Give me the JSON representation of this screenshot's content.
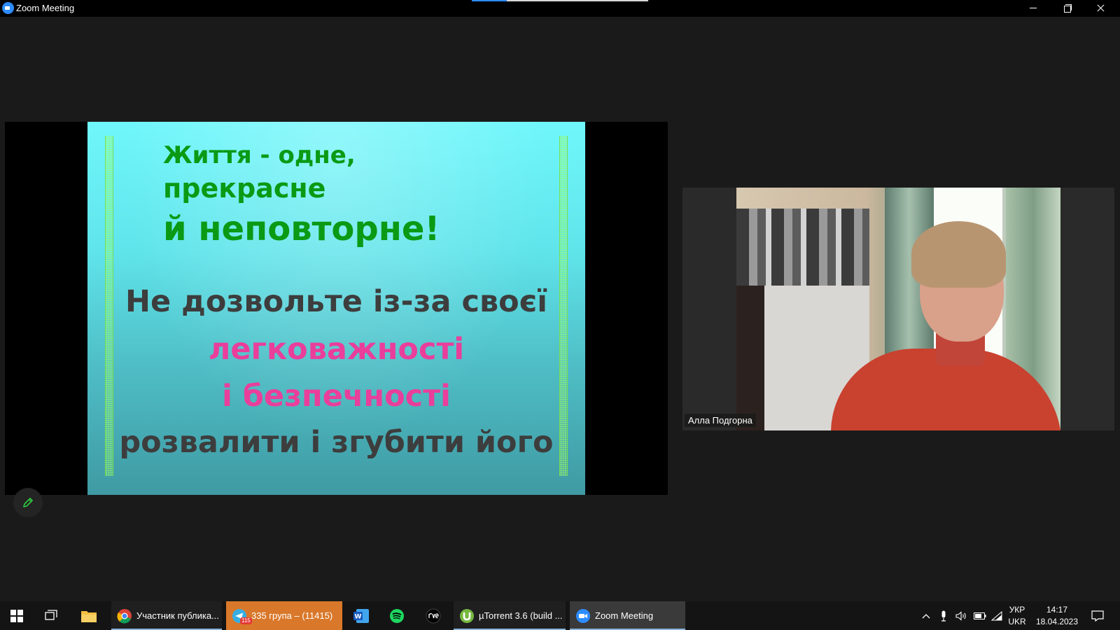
{
  "window": {
    "title": "Zoom Meeting"
  },
  "slide": {
    "line1": "Життя -  одне,",
    "line2": "прекрасне",
    "line3": "й неповторне!",
    "line4": "Не дозвольте із-за своєї",
    "line5": "легковажності",
    "line6": "і безпечності",
    "line7": "розвалити і згубити його"
  },
  "participant": {
    "name": "Алла Подгорна"
  },
  "taskbar": {
    "apps": [
      {
        "name": "chrome",
        "label": "Участник публика..."
      },
      {
        "name": "telegram",
        "label": "335 група – (11415)",
        "badge": "115"
      },
      {
        "name": "utorrent",
        "label": "µTorrent 3.6  (build ..."
      },
      {
        "name": "zoom",
        "label": "Zoom Meeting"
      }
    ],
    "lang_top": "УКР",
    "lang_bottom": "UKR",
    "time": "14:17",
    "date": "18.04.2023"
  },
  "colors": {
    "slide_green": "#0a9a14",
    "slide_pink": "#ea3e9b",
    "slide_gray": "#3d3d3d",
    "zoom_blue": "#2d8cff",
    "telegram_active": "#d9782a"
  }
}
